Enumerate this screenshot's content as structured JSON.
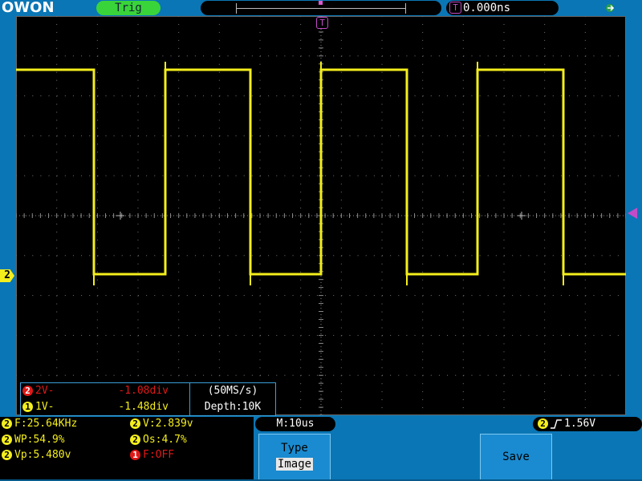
{
  "header": {
    "brand": "OWON",
    "trigger_status": "Trig",
    "trigger_marker_letter": "T",
    "horizontal_position": "0.000ns",
    "usb_icon": "usb-icon"
  },
  "channel2_marker": "2",
  "cursor": {
    "rows": [
      {
        "channel": "2",
        "label": "2V-",
        "value": "-1.08div"
      },
      {
        "channel": "1",
        "label": "1V-",
        "value": "-1.48div"
      }
    ]
  },
  "acquisition": {
    "sample_rate": "(50MS/s)",
    "depth": "Depth:10K"
  },
  "measurements": {
    "items": [
      {
        "channel": "2",
        "text": "F:25.64KHz"
      },
      {
        "channel": "2",
        "text": "V:2.839v"
      },
      {
        "channel": "2",
        "text": "WP:54.9%"
      },
      {
        "channel": "2",
        "text": "Os:4.7%"
      },
      {
        "channel": "2",
        "text": "Vp:5.480v"
      },
      {
        "channel": "1",
        "text": "F:OFF"
      }
    ]
  },
  "timebase": "M:10us",
  "trigger_level": {
    "channel": "2",
    "edge_icon": "rising-edge-icon",
    "value": "1.56V"
  },
  "softkeys": {
    "type_label": "Type",
    "type_value": "Image",
    "save_label": "Save"
  },
  "colors": {
    "screen_bg": "#000000",
    "frame_bg": "#0a76b5",
    "ch2_trace": "#f4ee1c",
    "ch1": "#e01818",
    "trigger": "#c24cc8",
    "trig_status": "#39d43a"
  }
}
